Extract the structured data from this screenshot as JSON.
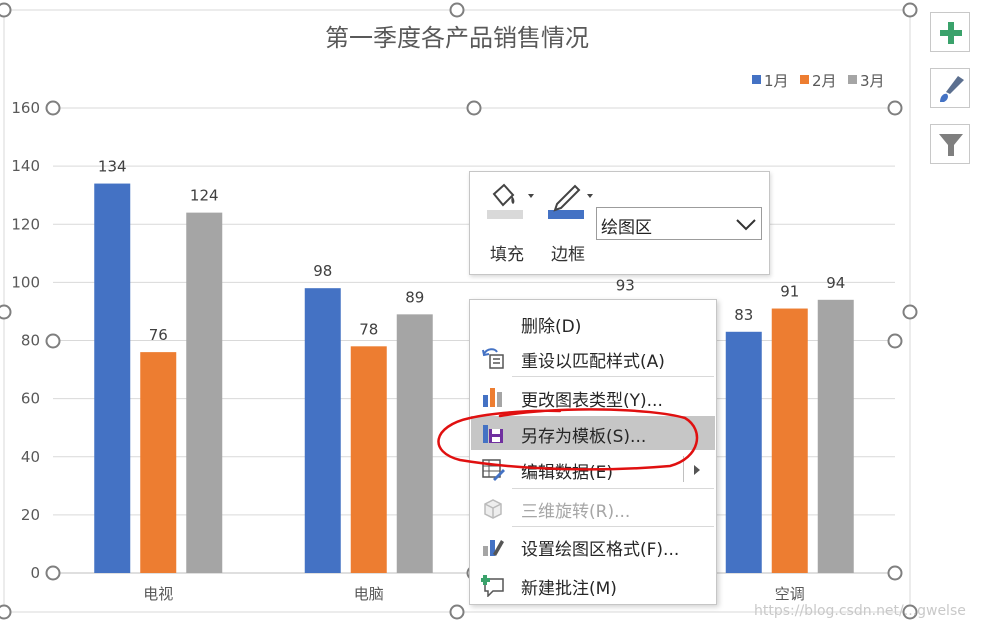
{
  "chart_data": {
    "type": "bar",
    "title": "第一季度各产品销售情况",
    "categories": [
      "电视",
      "电脑",
      "",
      "空调"
    ],
    "series": [
      {
        "name": "1月",
        "color": "#4472C4",
        "values": [
          134,
          98,
          null,
          83
        ]
      },
      {
        "name": "2月",
        "color": "#ED7D31",
        "values": [
          76,
          78,
          null,
          91
        ]
      },
      {
        "name": "3月",
        "color": "#A5A5A5",
        "values": [
          124,
          89,
          93,
          94
        ]
      }
    ],
    "y_ticks": [
      "0",
      "20",
      "40",
      "60",
      "80",
      "100",
      "120",
      "140",
      "160"
    ],
    "ylim": [
      0,
      160
    ],
    "grid": true,
    "legend": "top-right",
    "data_labels": true
  },
  "mini_toolbar": {
    "fill_label": "填充",
    "border_label": "边框",
    "selected_element": "绘图区"
  },
  "context_menu": {
    "items": [
      {
        "label": "删除(D)",
        "icon": "delete-icon",
        "enabled": true
      },
      {
        "label": "重设以匹配样式(A)",
        "icon": "reset-style-icon",
        "enabled": true
      },
      {
        "label": "更改图表类型(Y)...",
        "icon": "chart-type-icon",
        "enabled": true
      },
      {
        "label": "另存为模板(S)...",
        "icon": "save-template-icon",
        "enabled": true,
        "highlighted": true
      },
      {
        "label": "编辑数据(E)",
        "icon": "edit-data-icon",
        "enabled": true,
        "submenu": true
      },
      {
        "label": "三维旋转(R)...",
        "icon": "3d-rotation-icon",
        "enabled": false
      },
      {
        "label": "设置绘图区格式(F)...",
        "icon": "format-plot-area-icon",
        "enabled": true
      },
      {
        "label": "新建批注(M)",
        "icon": "new-comment-icon",
        "enabled": true
      }
    ]
  },
  "side_buttons": [
    "chart-elements-icon",
    "chart-styles-icon",
    "chart-filters-icon"
  ],
  "watermark": "https://blog.csdn.net/...gwelse",
  "annotation_color": "#E01010"
}
